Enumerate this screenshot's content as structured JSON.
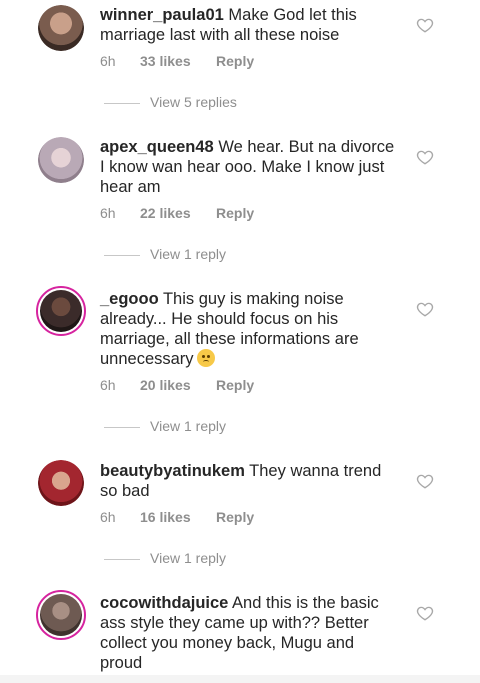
{
  "comments": [
    {
      "username": "winner_paula01",
      "text": "Make God let this marriage last with all these noise",
      "time": "6h",
      "likes": "33 likes",
      "reply": "Reply",
      "view_replies": "View 5 replies",
      "avatar_color": "#7a5c4e"
    },
    {
      "username": "apex_queen48",
      "text": "We hear. But na divorce I know wan hear ooo. Make I know just hear am",
      "time": "6h",
      "likes": "22 likes",
      "reply": "Reply",
      "view_replies": "View 1 reply",
      "avatar_color": "#b9a9b6"
    },
    {
      "username": "_egooo",
      "text": "This guy is making noise already... He should focus on his marriage, all these informations are unnecessary",
      "time": "6h",
      "likes": "20 likes",
      "reply": "Reply",
      "view_replies": "View 1 reply",
      "avatar_color": "#3b2b2a"
    },
    {
      "username": "beautybyatinukem",
      "text": "They wanna trend so bad",
      "time": "6h",
      "likes": "16 likes",
      "reply": "Reply",
      "view_replies": "View 1 reply",
      "avatar_color": "#a3262f"
    },
    {
      "username": "cocowithdajuice",
      "text": "And this is the basic ass style they came up with?? Better collect you money back, Mugu and proud",
      "avatar_color": "#6e5a52"
    }
  ],
  "icons": {
    "like": "heart-outline-icon",
    "emoji": "sad-face-emoji"
  },
  "colors": {
    "text": "#262626",
    "muted": "#8e8e8e",
    "story_ring": "#d6249f"
  }
}
